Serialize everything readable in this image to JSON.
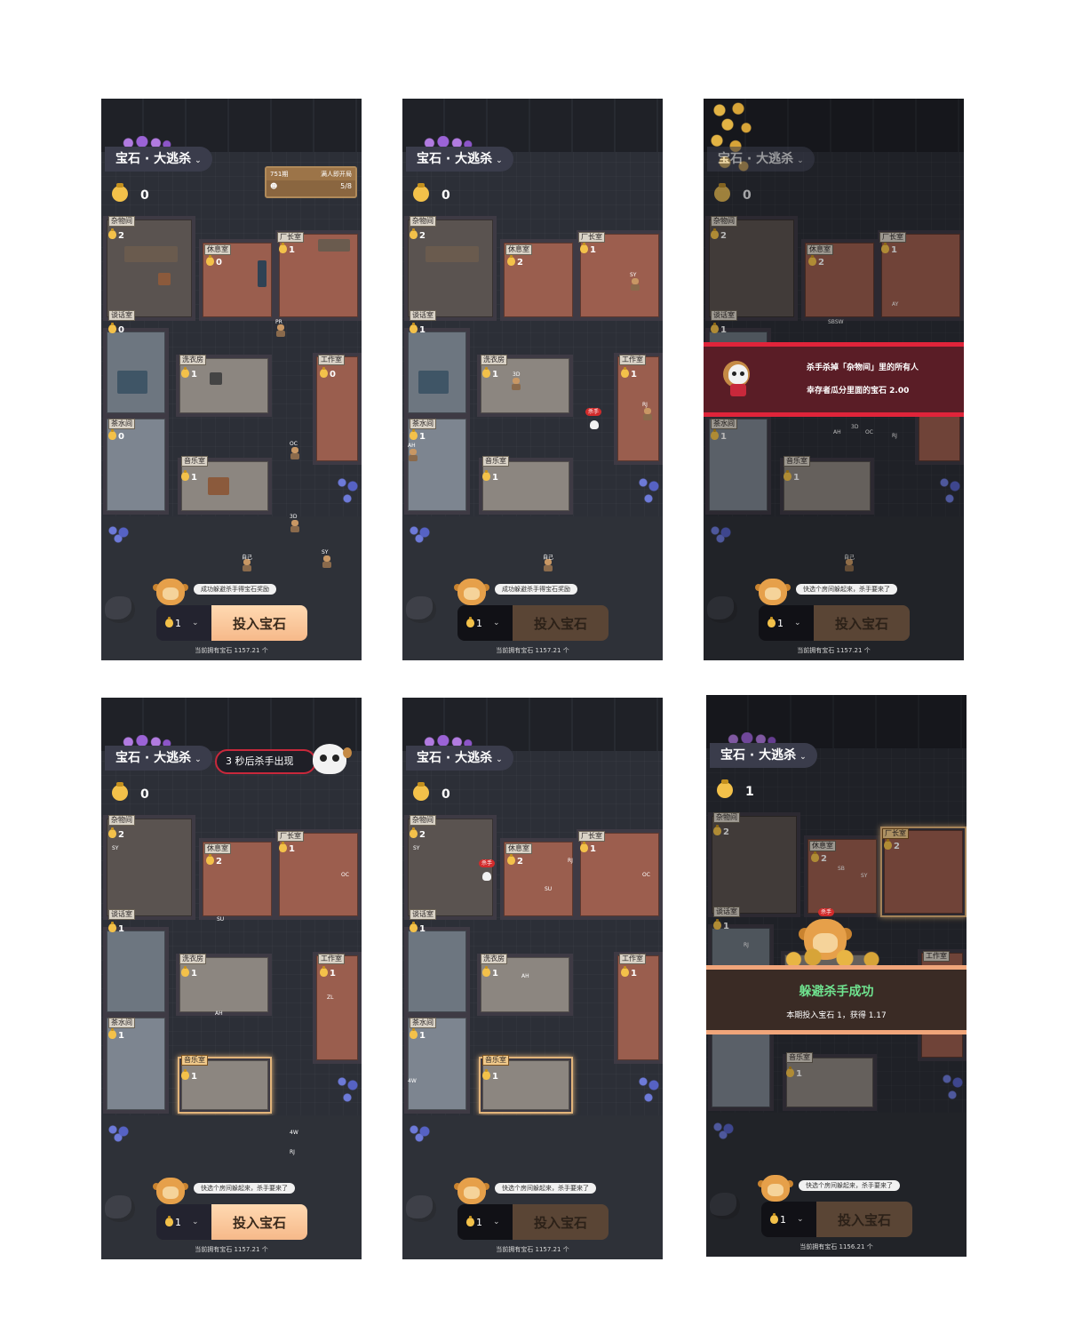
{
  "game": {
    "title": "宝石 · 大逃杀",
    "bet_button": "投入宝石",
    "bet_qty": "1",
    "owned_prefix": "当前拥有宝石"
  },
  "rooms": {
    "storage": "杂物间",
    "rest": "休息室",
    "boss": "厂长室",
    "talk": "谈话室",
    "laundry": "洗衣房",
    "work": "工作室",
    "tea": "茶水间",
    "music": "音乐室"
  },
  "screens": [
    {
      "balance": "0",
      "round": "751期",
      "round_status": "满人即开局",
      "players": "5/8",
      "counts": {
        "storage": "2",
        "rest": "0",
        "boss": "1",
        "talk": "0",
        "laundry": "1",
        "work": "0",
        "tea": "0",
        "music": "1"
      },
      "tip": "成功躲避杀手得宝石奖励",
      "owned": "当前拥有宝石 1157.21 个",
      "player_tags": [
        "PR",
        "OC",
        "3D",
        "SY",
        "自己"
      ]
    },
    {
      "balance": "0",
      "counts": {
        "storage": "2",
        "rest": "2",
        "boss": "1",
        "talk": "1",
        "laundry": "1",
        "work": "1",
        "tea": "1",
        "music": "1"
      },
      "tip": "成功躲避杀手得宝石奖励",
      "owned": "当前拥有宝石 1157.21 个",
      "killer_label": "杀手",
      "player_tags": [
        "SY",
        "3D",
        "RJ",
        "AH",
        "自己"
      ]
    },
    {
      "balance": "0",
      "counts": {
        "storage": "2",
        "rest": "2",
        "boss": "1",
        "talk": "1",
        "tea": "1",
        "music": "1"
      },
      "kill_line1": "杀手杀掉「杂物间」里的所有人",
      "kill_line2": "幸存者瓜分里面的宝石 2.00",
      "tip": "快选个房间躲起来，杀手要来了",
      "owned": "当前拥有宝石 1157.21 个",
      "player_tags": [
        "SBSW",
        "AY",
        "AH",
        "3D",
        "OC",
        "RJ",
        "自己"
      ]
    },
    {
      "balance": "0",
      "countdown": "3 秒后杀手出现",
      "counts": {
        "storage": "2",
        "rest": "2",
        "boss": "1",
        "talk": "1",
        "laundry": "1",
        "work": "1",
        "tea": "1",
        "music": "1"
      },
      "tip": "快选个房间躲起来，杀手要来了",
      "owned": "当前拥有宝石 1157.21 个",
      "player_tags": [
        "SY",
        "SU",
        "OC",
        "AH",
        "ZL",
        "4W",
        "RJ"
      ]
    },
    {
      "balance": "0",
      "counts": {
        "storage": "2",
        "rest": "2",
        "boss": "1",
        "talk": "1",
        "laundry": "1",
        "work": "1",
        "tea": "1",
        "music": "1"
      },
      "tip": "快选个房间躲起来，杀手要来了",
      "owned": "当前拥有宝石 1157.21 个",
      "killer_label": "杀手",
      "player_tags": [
        "SY",
        "SU",
        "RJ",
        "OC",
        "AH",
        "4W"
      ]
    },
    {
      "balance": "1",
      "counts": {
        "storage": "2",
        "rest": "2",
        "boss": "2",
        "talk": "1",
        "music": "1"
      },
      "success_title": "躲避杀手成功",
      "success_sub": "本期投入宝石 1，获得 1.17",
      "killer_label": "杀手",
      "tip": "快选个房间躲起来，杀手要来了",
      "owned": "当前拥有宝石 1156.21 个",
      "player_tags": [
        "SB",
        "SY",
        "RJ"
      ]
    }
  ],
  "colors": {
    "accent": "#f6b98a",
    "killer_red": "#e0243a",
    "success_green": "#6fe38f",
    "coin": "#f3c14a"
  },
  "icons": [
    "coin-bag-icon",
    "chevron-down-icon",
    "skull-icon",
    "monkey-avatar-icon",
    "killer-badge-icon"
  ]
}
